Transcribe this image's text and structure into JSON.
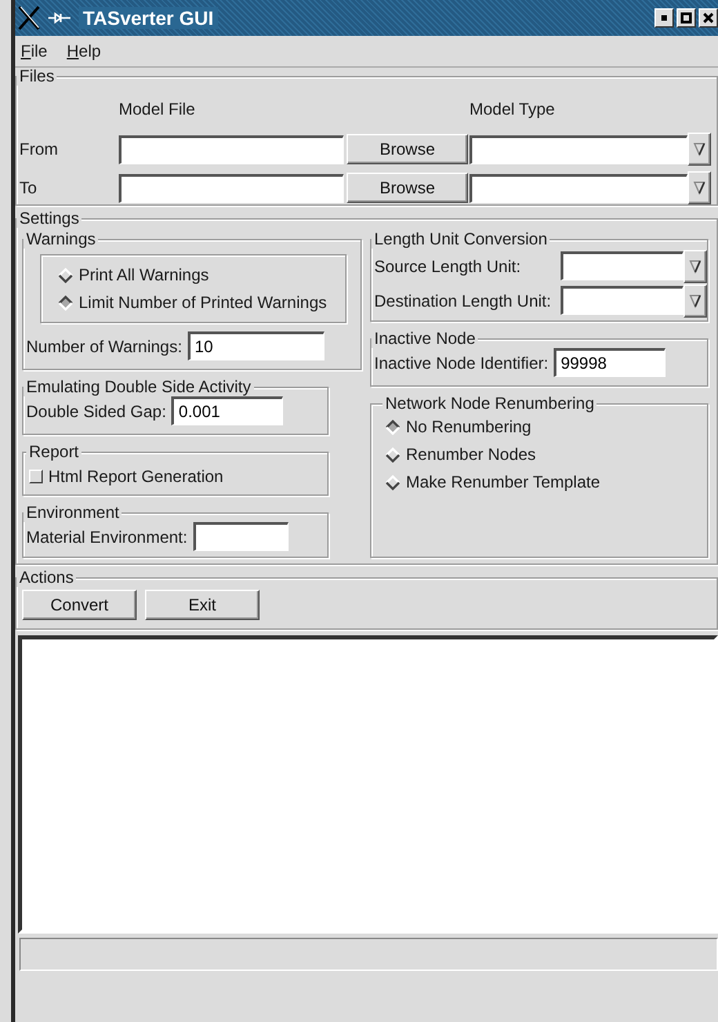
{
  "window": {
    "title": "TASverter GUI"
  },
  "menu": [
    {
      "label": "File"
    },
    {
      "label": "Help"
    }
  ],
  "files": {
    "title": "Files",
    "columns": [
      "Model File",
      "Model Type"
    ],
    "rows": [
      {
        "label": "From",
        "button": "Browse"
      },
      {
        "label": "To",
        "button": "Browse"
      }
    ]
  },
  "settings": {
    "title": "Settings",
    "warnings": {
      "title": "Warnings",
      "options": [
        {
          "label": "Print All Warnings",
          "selected": false
        },
        {
          "label": "Limit Number of Printed Warnings",
          "selected": true
        }
      ],
      "field": {
        "label": "Number of Warnings:",
        "value": "10"
      }
    },
    "double_side": {
      "title": "Emulating Double Side Activity",
      "field": {
        "label": "Double Sided Gap:",
        "value": "0.001"
      }
    },
    "report": {
      "title": "Report",
      "checkbox": {
        "label": "Html Report Generation",
        "checked": false
      }
    },
    "environment": {
      "title": "Environment",
      "field": {
        "label": "Material Environment:"
      }
    },
    "length_units": {
      "title": "Length Unit Conversion",
      "fields": [
        {
          "label": "Source Length Unit:"
        },
        {
          "label": "Destination Length Unit:"
        }
      ]
    },
    "inactive_node": {
      "title": "Inactive Node",
      "field": {
        "label": "Inactive Node Identifier:",
        "value": "99998"
      }
    },
    "renumbering": {
      "title": "Network Node Renumbering",
      "options": [
        {
          "label": "No Renumbering",
          "selected": true
        },
        {
          "label": "Renumber Nodes",
          "selected": false
        },
        {
          "label": "Make Renumber Template",
          "selected": false
        }
      ]
    }
  },
  "actions": {
    "title": "Actions",
    "buttons": [
      "Convert",
      "Exit"
    ]
  }
}
